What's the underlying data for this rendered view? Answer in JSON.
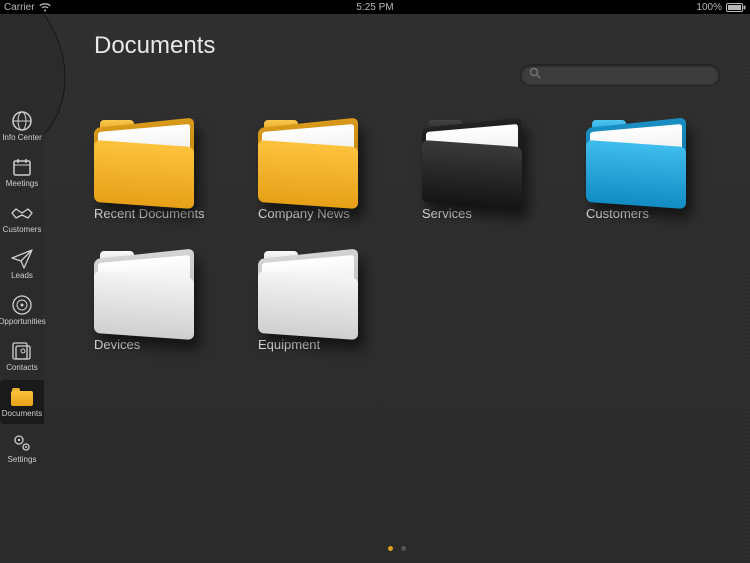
{
  "statusbar": {
    "carrier": "Carrier",
    "time": "5:25 PM",
    "battery": "100%"
  },
  "page": {
    "title": "Documents"
  },
  "search": {
    "placeholder": ""
  },
  "sidebar": {
    "items": [
      {
        "label": "Info Center",
        "icon": "globe-icon"
      },
      {
        "label": "Meetings",
        "icon": "calendar-icon"
      },
      {
        "label": "Customers",
        "icon": "handshake-icon"
      },
      {
        "label": "Leads",
        "icon": "paperplane-icon"
      },
      {
        "label": "Opportunities",
        "icon": "target-icon"
      },
      {
        "label": "Contacts",
        "icon": "contacts-icon"
      },
      {
        "label": "Documents",
        "icon": "folder-icon",
        "active": true
      },
      {
        "label": "Settings",
        "icon": "gears-icon"
      }
    ]
  },
  "folders": [
    {
      "label": "Recent Documents",
      "color": "gold"
    },
    {
      "label": "Company News",
      "color": "gold"
    },
    {
      "label": "Services",
      "color": "dark"
    },
    {
      "label": "Customers",
      "color": "blue"
    },
    {
      "label": "Devices",
      "color": "white"
    },
    {
      "label": "Equipment",
      "color": "white"
    }
  ],
  "pager": {
    "pages": 2,
    "active": 0
  },
  "colors": {
    "accent": "#e0a020"
  }
}
